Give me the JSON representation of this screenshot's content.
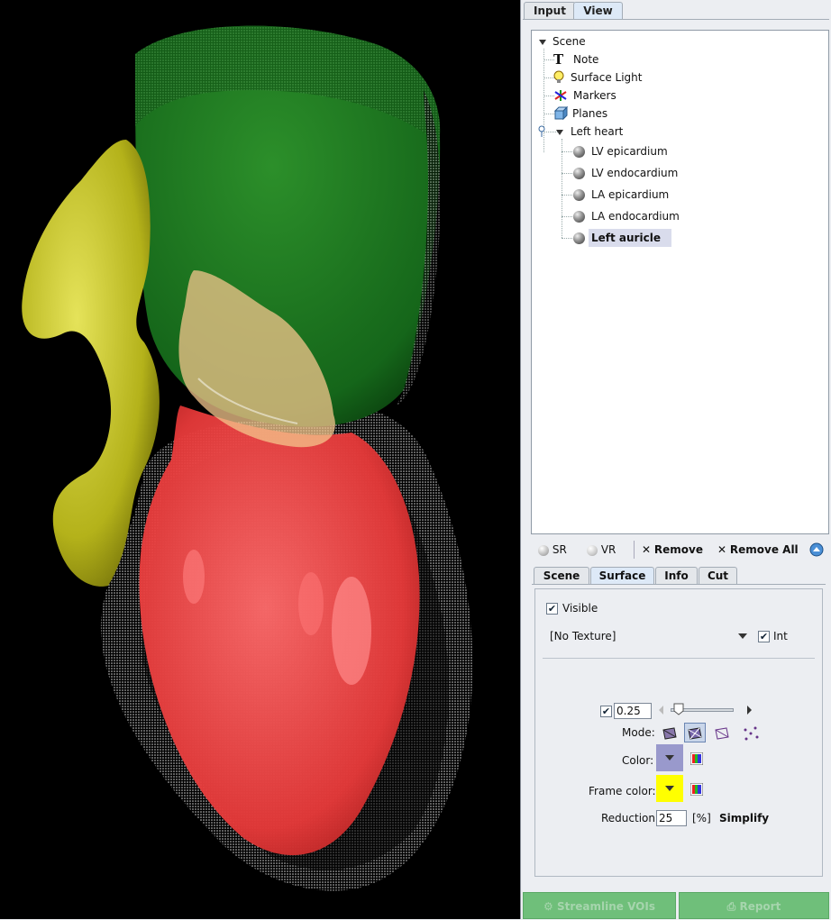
{
  "tabs": [
    {
      "label": "Input",
      "active": false
    },
    {
      "label": "View",
      "active": true
    }
  ],
  "tree": {
    "scene": "Scene",
    "note": "Note",
    "note_icon_glyph": "T",
    "surface_light": "Surface Light",
    "markers": "Markers",
    "planes": "Planes",
    "left_heart": "Left heart",
    "children": [
      {
        "label": "LV epicardium",
        "selected": false
      },
      {
        "label": "LV endocardium",
        "selected": false
      },
      {
        "label": "LA epicardium",
        "selected": false
      },
      {
        "label": "LA endocardium",
        "selected": false
      },
      {
        "label": "Left auricle",
        "selected": true
      }
    ]
  },
  "toolbar": {
    "sr": "SR",
    "vr": "VR",
    "remove": "Remove",
    "remove_all": "Remove All"
  },
  "subtabs": [
    {
      "label": "Scene",
      "active": false
    },
    {
      "label": "Surface",
      "active": true
    },
    {
      "label": "Info",
      "active": false
    },
    {
      "label": "Cut",
      "active": false
    }
  ],
  "surface": {
    "visible_label": "Visible",
    "visible_checked": true,
    "texture": "[No Texture]",
    "int_label": "Int",
    "int_checked": true,
    "opacity_checked": true,
    "opacity_value": "0.25",
    "opacity_slider_fraction": 0.05,
    "mode_label": "Mode:",
    "mode_selected": 1,
    "color_label": "Color:",
    "color": "#9999cc",
    "frame_color_label": "Frame color:",
    "frame_color": "#ffff00",
    "reduction_label": "Reduction",
    "reduction_value": "25",
    "reduction_unit": "[%]",
    "simplify_label": "Simplify"
  },
  "bottom_buttons": {
    "streamline": "Streamline VOIs",
    "report": "Report"
  },
  "colors": {
    "lv_epicardium": "#ffffff",
    "lv_endocardium": "#e03030",
    "la_epicardium": "#1d8a1d",
    "la_endocardium": "#f4c58c",
    "left_auricle": "#c9c72a"
  }
}
